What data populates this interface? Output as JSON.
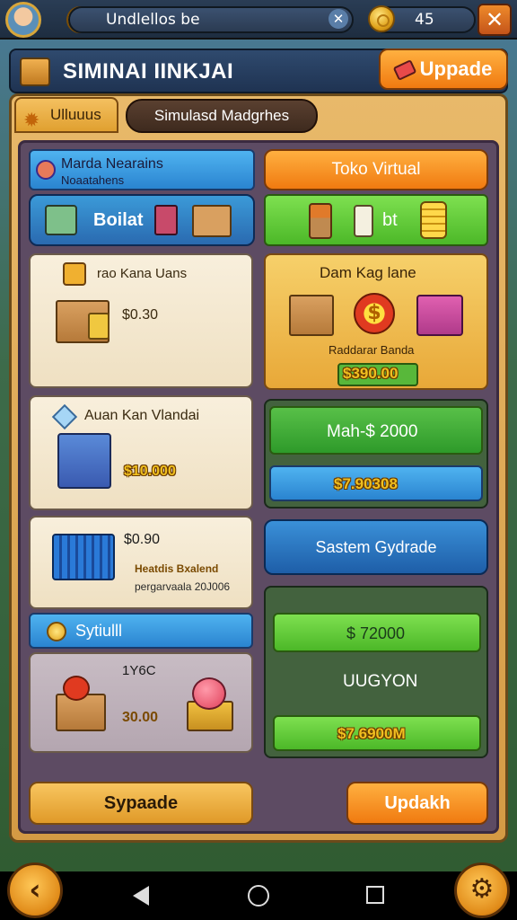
{
  "topbar": {
    "title": "Undlellos be",
    "currency": "45",
    "search_clear_icon": "x-icon",
    "close_icon": "x-icon"
  },
  "header": {
    "title": "SIMINAI IINKJAI",
    "upgrade_label": "Uppade"
  },
  "tabs": [
    {
      "label": "Ulluuus",
      "active": true
    },
    {
      "label": "Simulasd Madgrhes",
      "active": false
    }
  ],
  "left": {
    "info_title": "Marda Nearains",
    "info_sub": "Noaatahens",
    "boiler_label": "Boilat",
    "card1": {
      "title": "rao Kana Uans",
      "price": "$0.30"
    },
    "card2": {
      "title": "Auan Kan Vlandai",
      "price": "$10.000"
    },
    "card3": {
      "price": "$0.90",
      "line1": "Heatdis Bxalend",
      "line2": "pergarvaala 20J006"
    },
    "sytiull_label": "Sytiulll",
    "card4": {
      "count": "1Y6C",
      "price": "30.00"
    },
    "bottom_button": "Sypaade"
  },
  "right": {
    "toko_label": "Toko Virtual",
    "bt_label": "bt",
    "featured": {
      "title": "Dam Kag lane",
      "subtitle": "Raddarar Banda",
      "price": "$390.00"
    },
    "mah_label": "Mah-$ 2000",
    "mah_price": "$7.90308",
    "system_upgrade": "Sastem Gydrade",
    "price_a": "$ 72000",
    "uugyon": "UUGYON",
    "price_b": "$7.6900M",
    "bottom_button": "Updakh"
  },
  "nav": {
    "back_icon": "chevron-left-icon",
    "settings_icon": "gear-icon"
  }
}
